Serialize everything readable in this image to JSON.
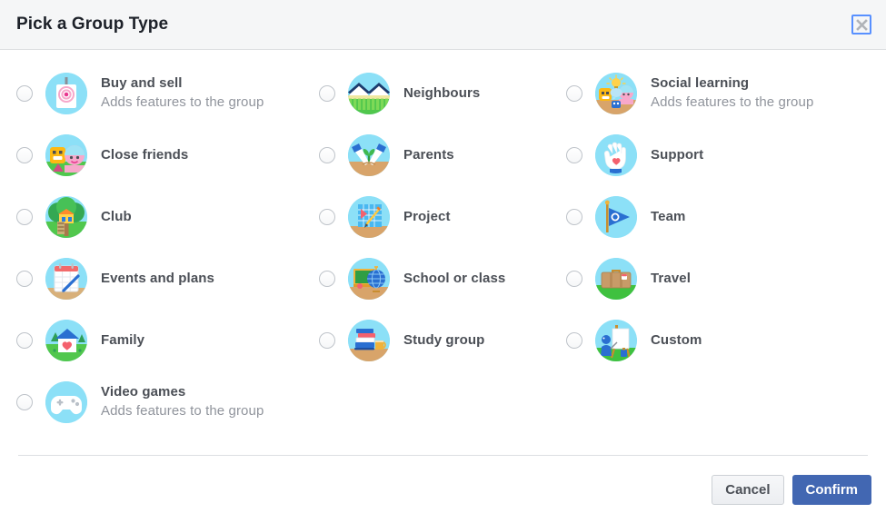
{
  "dialog": {
    "title": "Pick a Group Type",
    "close_icon": "close-x-icon",
    "accent_color": "#4267b2",
    "header_bg": "#f5f6f7",
    "focus_outline_color": "#5890ff"
  },
  "columns": [
    {
      "options": [
        {
          "title": "Buy and sell",
          "subtitle": "Adds features to the group",
          "icon": "price-tag-icon",
          "selected": false
        },
        {
          "title": "Close friends",
          "subtitle": "",
          "icon": "two-friends-icon",
          "selected": false
        },
        {
          "title": "Club",
          "subtitle": "",
          "icon": "treehouse-icon",
          "selected": false
        },
        {
          "title": "Events and plans",
          "subtitle": "",
          "icon": "calendar-icon",
          "selected": false
        },
        {
          "title": "Family",
          "subtitle": "",
          "icon": "house-heart-icon",
          "selected": false
        },
        {
          "title": "Video games",
          "subtitle": "Adds features to the group",
          "icon": "gamepad-icon",
          "selected": false
        }
      ]
    },
    {
      "options": [
        {
          "title": "Neighbours",
          "subtitle": "",
          "icon": "houses-fence-icon",
          "selected": false
        },
        {
          "title": "Parents",
          "subtitle": "",
          "icon": "hands-sprout-icon",
          "selected": false
        },
        {
          "title": "Project",
          "subtitle": "",
          "icon": "blueprint-pencil-icon",
          "selected": false
        },
        {
          "title": "School or class",
          "subtitle": "",
          "icon": "chalkboard-globe-icon",
          "selected": false
        },
        {
          "title": "Study group",
          "subtitle": "",
          "icon": "books-mug-icon",
          "selected": false
        }
      ]
    },
    {
      "options": [
        {
          "title": "Social learning",
          "subtitle": "Adds features to the group",
          "icon": "people-lightbulb-icon",
          "selected": false
        },
        {
          "title": "Support",
          "subtitle": "",
          "icon": "hand-heart-icon",
          "selected": false
        },
        {
          "title": "Team",
          "subtitle": "",
          "icon": "pennant-flag-icon",
          "selected": false
        },
        {
          "title": "Travel",
          "subtitle": "",
          "icon": "suitcase-icon",
          "selected": false
        },
        {
          "title": "Custom",
          "subtitle": "",
          "icon": "easel-painter-icon",
          "selected": false
        }
      ]
    }
  ],
  "footer": {
    "cancel_label": "Cancel",
    "confirm_label": "Confirm"
  }
}
